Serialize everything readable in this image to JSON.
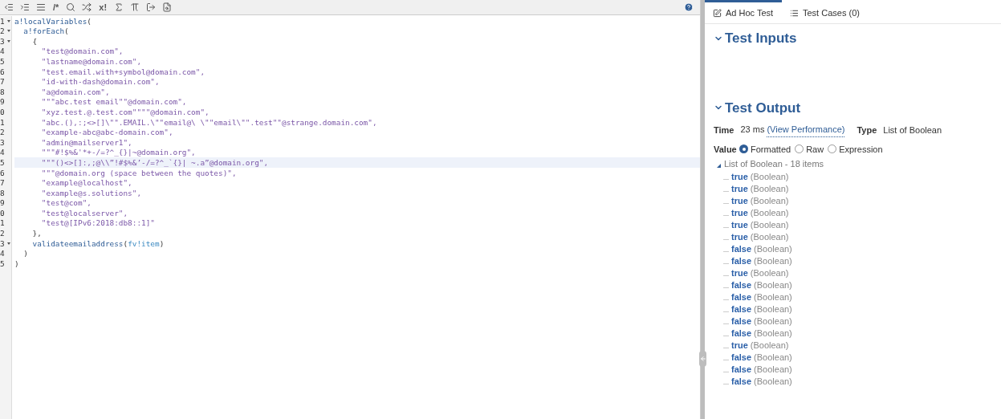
{
  "toolbar": {
    "buttons": [
      {
        "kind": "icon"
      },
      {
        "kind": "icon"
      },
      {
        "kind": "icon"
      },
      {
        "kind": "text",
        "label": "/*"
      },
      {
        "kind": "icon"
      },
      {
        "kind": "icon"
      },
      {
        "kind": "text",
        "label": "x!"
      },
      {
        "kind": "icon"
      },
      {
        "kind": "icon"
      },
      {
        "kind": "icon"
      },
      {
        "kind": "icon"
      }
    ]
  },
  "editor": {
    "lines": [
      {
        "number": "1",
        "fold": true,
        "current": false,
        "tokens": [
          {
            "kind": "func",
            "text": "a!localVariables"
          },
          {
            "kind": "punct",
            "text": "("
          }
        ]
      },
      {
        "number": "2",
        "fold": true,
        "current": false,
        "tokens": [
          {
            "kind": "func",
            "text": "  a!forEach"
          },
          {
            "kind": "punct",
            "text": "("
          }
        ]
      },
      {
        "number": "3",
        "fold": true,
        "current": false,
        "tokens": [
          {
            "kind": "punct",
            "text": "    {"
          }
        ]
      },
      {
        "number": "4",
        "fold": false,
        "current": false,
        "tokens": [
          {
            "kind": "string",
            "text": "      \"test@domain.com\","
          }
        ]
      },
      {
        "number": "5",
        "fold": false,
        "current": false,
        "tokens": [
          {
            "kind": "string",
            "text": "      \"lastname@domain.com\","
          }
        ]
      },
      {
        "number": "6",
        "fold": false,
        "current": false,
        "tokens": [
          {
            "kind": "string",
            "text": "      \"test.email.with+symbol@domain.com\","
          }
        ]
      },
      {
        "number": "7",
        "fold": false,
        "current": false,
        "tokens": [
          {
            "kind": "string",
            "text": "      \"id-with-dash@domain.com\","
          }
        ]
      },
      {
        "number": "8",
        "fold": false,
        "current": false,
        "tokens": [
          {
            "kind": "string",
            "text": "      \"a@domain.com\","
          }
        ]
      },
      {
        "number": "9",
        "fold": false,
        "current": false,
        "tokens": [
          {
            "kind": "string",
            "text": "      \"\"\"abc.test email\"\"@domain.com\","
          }
        ]
      },
      {
        "number": "0",
        "fold": false,
        "current": false,
        "tokens": [
          {
            "kind": "string",
            "text": "      \"xyz.test.@.test.com\"\"\"\"@domain.com\","
          }
        ]
      },
      {
        "number": "1",
        "fold": false,
        "current": false,
        "tokens": [
          {
            "kind": "string",
            "text": "      \"abc.(),:;<>[]\\\"\".EMAIL.\\\"\"email@\\ \\\"\"email\\\"\".test\"\"@strange.domain.com\","
          }
        ]
      },
      {
        "number": "2",
        "fold": false,
        "current": false,
        "tokens": [
          {
            "kind": "string",
            "text": "      \"example-abc@abc-domain.com\","
          }
        ]
      },
      {
        "number": "3",
        "fold": false,
        "current": false,
        "tokens": [
          {
            "kind": "string",
            "text": "      \"admin@mailserver1\","
          }
        ]
      },
      {
        "number": "4",
        "fold": false,
        "current": false,
        "tokens": [
          {
            "kind": "string",
            "text": "      \"\"\"#!$%&'*+-/=?^_{}|~@domain.org\","
          }
        ]
      },
      {
        "number": "5",
        "fold": false,
        "current": true,
        "tokens": [
          {
            "kind": "string",
            "text": "      \"\"\"()<>[]:,;@\\\\”!#$%&’-/=?^_`{}| ~.a”@domain.org\","
          }
        ]
      },
      {
        "number": "6",
        "fold": false,
        "current": false,
        "tokens": [
          {
            "kind": "string",
            "text": "      \"\"\"@domain.org (space between the quotes)\","
          }
        ]
      },
      {
        "number": "7",
        "fold": false,
        "current": false,
        "tokens": [
          {
            "kind": "string",
            "text": "      \"example@localhost\","
          }
        ]
      },
      {
        "number": "8",
        "fold": false,
        "current": false,
        "tokens": [
          {
            "kind": "string",
            "text": "      \"example@s.solutions\","
          }
        ]
      },
      {
        "number": "9",
        "fold": false,
        "current": false,
        "tokens": [
          {
            "kind": "string",
            "text": "      \"test@com\","
          }
        ]
      },
      {
        "number": "0",
        "fold": false,
        "current": false,
        "tokens": [
          {
            "kind": "string",
            "text": "      \"test@localserver\","
          }
        ]
      },
      {
        "number": "1",
        "fold": false,
        "current": false,
        "tokens": [
          {
            "kind": "string",
            "text": "      \"test@[IPv6:2018:db8::1]\""
          }
        ]
      },
      {
        "number": "2",
        "fold": false,
        "current": false,
        "tokens": [
          {
            "kind": "punct",
            "text": "    },"
          }
        ]
      },
      {
        "number": "3",
        "fold": true,
        "current": false,
        "tokens": [
          {
            "kind": "func",
            "text": "    validateemailaddress"
          },
          {
            "kind": "punct",
            "text": "("
          },
          {
            "kind": "var",
            "text": "fv!item"
          },
          {
            "kind": "punct",
            "text": ")"
          }
        ]
      },
      {
        "number": "4",
        "fold": false,
        "current": false,
        "tokens": [
          {
            "kind": "punct",
            "text": "  )"
          }
        ]
      },
      {
        "number": "5",
        "fold": false,
        "current": false,
        "tokens": [
          {
            "kind": "punct",
            "text": ")"
          }
        ]
      }
    ]
  },
  "tabs": [
    {
      "label": "Ad Hoc Test",
      "selected": true
    },
    {
      "label": "Test Cases (0)",
      "selected": false
    }
  ],
  "test_inputs": {
    "title": "Test Inputs"
  },
  "test_output": {
    "title": "Test Output",
    "time_label": "Time",
    "time": "23 ms",
    "view_performance": "(View Performance)",
    "type_label": "Type",
    "type": "List of Boolean",
    "value_label": "Value",
    "modes": [
      {
        "label": "Formatted",
        "selected": true
      },
      {
        "label": "Raw",
        "selected": false
      },
      {
        "label": "Expression",
        "selected": false
      }
    ],
    "tree_title": "List of Boolean - 18 items",
    "items": [
      {
        "value": "true",
        "type": "(Boolean)"
      },
      {
        "value": "true",
        "type": "(Boolean)"
      },
      {
        "value": "true",
        "type": "(Boolean)"
      },
      {
        "value": "true",
        "type": "(Boolean)"
      },
      {
        "value": "true",
        "type": "(Boolean)"
      },
      {
        "value": "true",
        "type": "(Boolean)"
      },
      {
        "value": "false",
        "type": "(Boolean)"
      },
      {
        "value": "false",
        "type": "(Boolean)"
      },
      {
        "value": "true",
        "type": "(Boolean)"
      },
      {
        "value": "false",
        "type": "(Boolean)"
      },
      {
        "value": "false",
        "type": "(Boolean)"
      },
      {
        "value": "false",
        "type": "(Boolean)"
      },
      {
        "value": "false",
        "type": "(Boolean)"
      },
      {
        "value": "false",
        "type": "(Boolean)"
      },
      {
        "value": "true",
        "type": "(Boolean)"
      },
      {
        "value": "false",
        "type": "(Boolean)"
      },
      {
        "value": "false",
        "type": "(Boolean)"
      },
      {
        "value": "false",
        "type": "(Boolean)"
      }
    ]
  }
}
